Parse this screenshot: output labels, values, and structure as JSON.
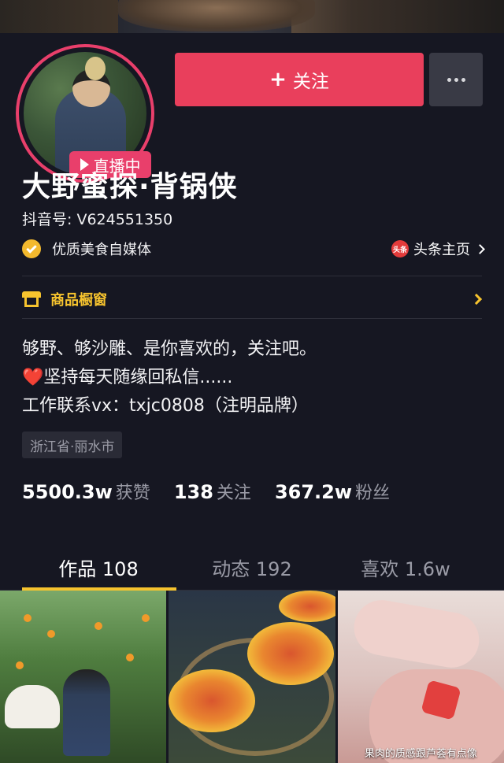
{
  "header": {
    "live_label": "直播中",
    "follow_label": "关注",
    "follow_plus": "+"
  },
  "profile": {
    "name": "大野蜜探·背锅侠",
    "douyin_id": "抖音号: V624551350",
    "certification": "优质美食自媒体",
    "toutiao_icon_text": "头条",
    "toutiao_label": "头条主页",
    "shop_label": "商品橱窗",
    "bio": [
      "够野、够沙雕、是你喜欢的，关注吧。",
      "坚持每天随缘回私信......",
      "工作联系vx：txjc0808（注明品牌）"
    ],
    "heart_glyph": "❤️",
    "location": "浙江省·丽水市"
  },
  "stats": [
    {
      "value": "5500.3w",
      "label": "获赞"
    },
    {
      "value": "138",
      "label": "关注"
    },
    {
      "value": "367.2w",
      "label": "粉丝"
    }
  ],
  "tabs": [
    {
      "label": "作品 108",
      "active": true
    },
    {
      "label": "动态 192",
      "active": false
    },
    {
      "label": "喜欢 1.6w",
      "active": false
    }
  ],
  "grid": {
    "captions": [
      "",
      "",
      "果肉的质感跟芦荟有点像"
    ]
  },
  "colors": {
    "background": "#161722",
    "accent_pink": "#e93f5c",
    "accent_yellow": "#f6c32e",
    "muted_text": "#9a9ba6"
  }
}
